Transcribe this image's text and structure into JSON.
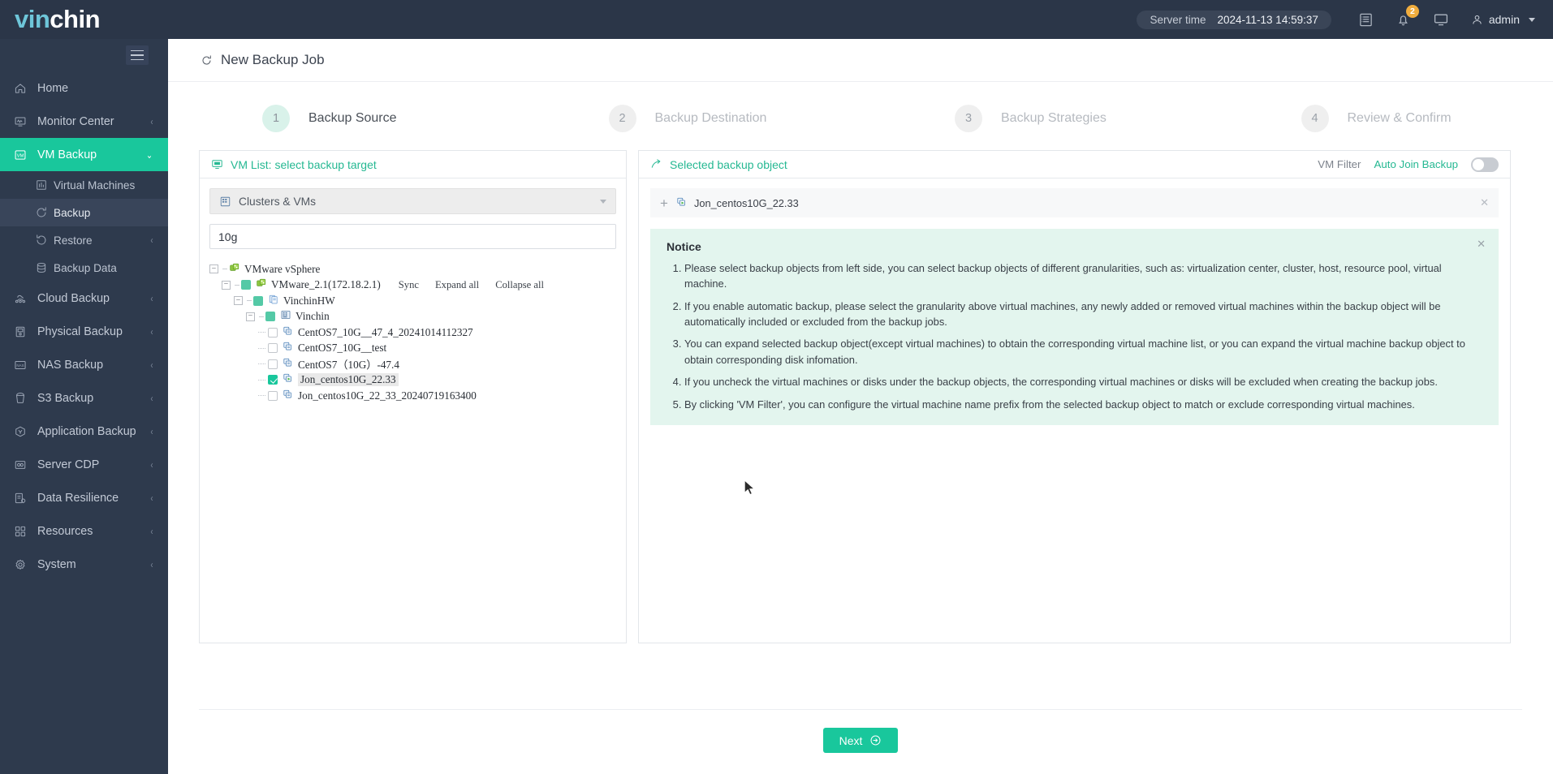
{
  "header": {
    "logo_vin": "vin",
    "logo_chin": "chin",
    "server_time_label": "Server time",
    "server_time_value": "2024-11-13 14:59:37",
    "notification_badge": "2",
    "user_name": "admin",
    "icons": [
      "log-icon",
      "bell-icon",
      "console-icon",
      "user-icon"
    ]
  },
  "sidebar": {
    "items": [
      {
        "label": "Home",
        "icon": "home-icon",
        "arrow": "",
        "active": false
      },
      {
        "label": "Monitor Center",
        "icon": "monitor-icon",
        "arrow": "‹",
        "active": false
      },
      {
        "label": "VM Backup",
        "icon": "vm-icon",
        "arrow": "⌄",
        "active": true
      },
      {
        "label": "Cloud Backup",
        "icon": "cloud-icon",
        "arrow": "‹",
        "active": false
      },
      {
        "label": "Physical Backup",
        "icon": "server-icon",
        "arrow": "‹",
        "active": false
      },
      {
        "label": "NAS Backup",
        "icon": "nas-icon",
        "arrow": "‹",
        "active": false
      },
      {
        "label": "S3 Backup",
        "icon": "bucket-icon",
        "arrow": "‹",
        "active": false
      },
      {
        "label": "Application Backup",
        "icon": "app-icon",
        "arrow": "‹",
        "active": false
      },
      {
        "label": "Server CDP",
        "icon": "cdp-icon",
        "arrow": "‹",
        "active": false
      },
      {
        "label": "Data Resilience",
        "icon": "resilience-icon",
        "arrow": "‹",
        "active": false
      },
      {
        "label": "Resources",
        "icon": "resources-icon",
        "arrow": "‹",
        "active": false
      },
      {
        "label": "System",
        "icon": "gear-icon",
        "arrow": "‹",
        "active": false
      }
    ],
    "sub_items": [
      {
        "label": "Virtual Machines",
        "icon": "chart-icon",
        "arrow": "",
        "selected": false
      },
      {
        "label": "Backup",
        "icon": "backup-icon",
        "arrow": "",
        "selected": true
      },
      {
        "label": "Restore",
        "icon": "restore-icon",
        "arrow": "‹",
        "selected": false
      },
      {
        "label": "Backup Data",
        "icon": "database-icon",
        "arrow": "",
        "selected": false
      }
    ]
  },
  "page": {
    "title": "New Backup Job",
    "title_icon": "refresh-icon"
  },
  "steps": [
    {
      "number": "1",
      "label": "Backup Source",
      "active": true
    },
    {
      "number": "2",
      "label": "Backup Destination",
      "active": false
    },
    {
      "number": "3",
      "label": "Backup Strategies",
      "active": false
    },
    {
      "number": "4",
      "label": "Review & Confirm",
      "active": false
    }
  ],
  "left_panel": {
    "title": "VM List: select backup target",
    "title_icon": "vm-list-icon",
    "select_value": "Clusters & VMs",
    "select_icon": "cluster-icon",
    "search_value": "10g",
    "search_placeholder": "",
    "tree_actions": [
      "Sync",
      "Expand all",
      "Collapse all"
    ],
    "tree": [
      {
        "label": "VMware vSphere",
        "depth": 0,
        "expander": "−",
        "checkbox": "none",
        "icon": "vsphere-icon",
        "selected": false
      },
      {
        "label": "VMware_2.1(172.18.2.1)",
        "depth": 1,
        "expander": "−",
        "checkbox": "indeterminate",
        "icon": "vsphere-icon",
        "selected": false,
        "actions": true
      },
      {
        "label": "VinchinHW",
        "depth": 2,
        "expander": "−",
        "checkbox": "indeterminate",
        "icon": "host-icon",
        "selected": false
      },
      {
        "label": "Vinchin",
        "depth": 3,
        "expander": "−",
        "checkbox": "indeterminate",
        "icon": "cluster-icon",
        "selected": false
      },
      {
        "label": "CentOS7_10G__47_4_20241014112327",
        "depth": 4,
        "expander": "leaf",
        "checkbox": "unchecked",
        "icon": "vm-stopped-icon",
        "selected": false
      },
      {
        "label": "CentOS7_10G__test",
        "depth": 4,
        "expander": "leaf",
        "checkbox": "unchecked",
        "icon": "vm-stopped-icon",
        "selected": false
      },
      {
        "label": "CentOS7（10G）-47.4",
        "depth": 4,
        "expander": "leaf",
        "checkbox": "unchecked",
        "icon": "vm-stopped-icon",
        "selected": false
      },
      {
        "label": "Jon_centos10G_22.33",
        "depth": 4,
        "expander": "leaf",
        "checkbox": "checked",
        "icon": "vm-running-icon",
        "selected": true
      },
      {
        "label": "Jon_centos10G_22_33_20240719163400",
        "depth": 4,
        "expander": "leaf-last",
        "checkbox": "unchecked",
        "icon": "vm-stopped-icon",
        "selected": false
      }
    ]
  },
  "right_panel": {
    "title": "Selected backup object",
    "title_icon": "selected-object-icon",
    "vm_filter_label": "VM Filter",
    "auto_join_label": "Auto Join Backup",
    "auto_join_on": false,
    "selected_objects": [
      {
        "name": "Jon_centos10G_22.33",
        "icon": "vm-running-icon",
        "add_icon": "plus-icon",
        "remove_icon": "close-icon"
      }
    ],
    "notice": {
      "title": "Notice",
      "close_icon": "close-icon",
      "items": [
        "Please select backup objects from left side, you can select backup objects of different granularities, such as: virtualization center, cluster, host, resource pool, virtual machine.",
        "If you enable automatic backup, please select the granularity above virtual machines, any newly added or removed virtual machines within the backup object will be automatically included or excluded from the backup jobs.",
        "You can expand selected backup object(except virtual machines) to obtain the corresponding virtual machine list, or you can expand the virtual machine backup object to obtain corresponding disk infomation.",
        "If you uncheck the virtual machines or disks under the backup objects, the corresponding virtual machines or disks will be excluded when creating the backup jobs.",
        "By clicking 'VM Filter', you can configure the virtual machine name prefix from the selected backup object to match or exclude corresponding virtual machines."
      ]
    }
  },
  "footer": {
    "next_label": "Next",
    "next_icon": "arrow-right-circle-icon"
  },
  "colors": {
    "brand_green": "#19c79c",
    "sidebar_bg": "#2e3a4d",
    "topbar_bg": "#2b3648",
    "notice_bg": "#e3f5ee",
    "badge_orange": "#f0ad3e",
    "logo_blue": "#6ec6d9"
  }
}
